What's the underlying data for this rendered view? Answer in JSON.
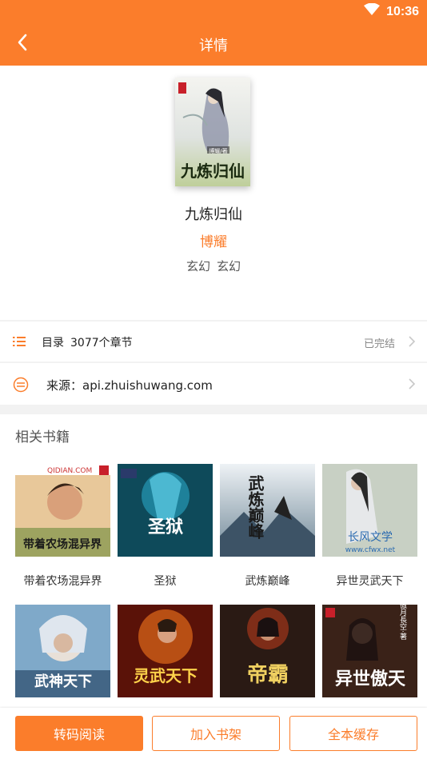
{
  "status_bar": {
    "time": "10:36",
    "wifi_icon": "wifi-icon",
    "battery_icon": "battery-icon"
  },
  "app_bar": {
    "title": "详情",
    "back_icon": "back-arrow-icon"
  },
  "book": {
    "cover_author_text": "博耀/著",
    "cover_title_text": "九炼归仙",
    "title": "九炼归仙",
    "author": "博耀",
    "tags": [
      "玄幻",
      "玄幻"
    ]
  },
  "toc": {
    "label": "目录",
    "chapters": "3077个章节",
    "status": "已完结"
  },
  "source": {
    "label": "来源：api.zhuishuwang.com"
  },
  "related": {
    "title": "相关书籍",
    "books": [
      {
        "name": "带着农场混异界",
        "cover_text": "带着农场混异界",
        "cover_top": "QIDIAN.COM"
      },
      {
        "name": "圣狱",
        "cover_text": "圣狱",
        "cover_top": ""
      },
      {
        "name": "武炼巅峰",
        "cover_text": "武炼巅峰",
        "cover_top": ""
      },
      {
        "name": "异世灵武天下",
        "cover_text": "长风文学",
        "cover_top": "www.cfwx.net"
      },
      {
        "name": "",
        "cover_text": "武神天下",
        "cover_top": ""
      },
      {
        "name": "",
        "cover_text": "灵武天下",
        "cover_top": ""
      },
      {
        "name": "",
        "cover_text": "帝霸",
        "cover_top": ""
      },
      {
        "name": "",
        "cover_text": "异世傲天",
        "cover_top": "傲月長空·著"
      }
    ]
  },
  "actions": {
    "read": "转码阅读",
    "shelf": "加入书架",
    "cache": "全本缓存"
  }
}
